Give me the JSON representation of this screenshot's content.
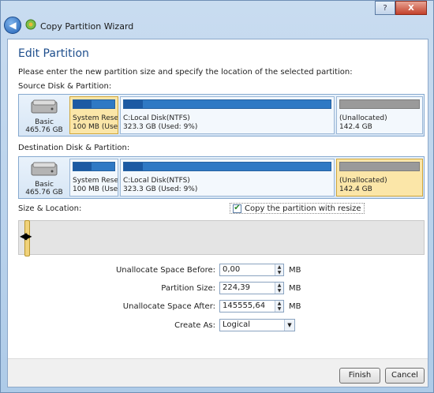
{
  "window": {
    "title": "Copy Partition Wizard",
    "minimize_glyph": "?",
    "close_glyph": "X"
  },
  "page": {
    "heading": "Edit Partition",
    "instructions": "Please enter the new partition size and specify the location of the selected partition:"
  },
  "source": {
    "label": "Source Disk & Partition:",
    "disk": {
      "type": "Basic",
      "size": "465.76 GB"
    },
    "partitions": [
      {
        "line1": "System Reser",
        "line2": "100 MB (Used:",
        "used_fraction": 0.45,
        "selected": true
      },
      {
        "line1": "C:Local Disk(NTFS)",
        "line2": "323.3 GB (Used: 9%)",
        "used_fraction": 0.09,
        "selected": false
      },
      {
        "line1": "(Unallocated)",
        "line2": "142.4 GB",
        "used_fraction": 0,
        "selected": false
      }
    ]
  },
  "destination": {
    "label": "Destination Disk & Partition:",
    "disk": {
      "type": "Basic",
      "size": "465.76 GB"
    },
    "partitions": [
      {
        "line1": "System Reser",
        "line2": "100 MB (Used:",
        "used_fraction": 0.45,
        "selected": false
      },
      {
        "line1": "C:Local Disk(NTFS)",
        "line2": "323.3 GB (Used: 9%)",
        "used_fraction": 0.09,
        "selected": false
      },
      {
        "line1": "(Unallocated)",
        "line2": "142.4 GB",
        "used_fraction": 0,
        "selected": true
      }
    ]
  },
  "size_location": {
    "label": "Size & Location:",
    "resize_checkbox_label": "Copy the partition with resize",
    "resize_checked": true
  },
  "form": {
    "before_label": "Unallocate Space Before:",
    "before_value": "0,00",
    "size_label": "Partition Size:",
    "size_value": "224,39",
    "after_label": "Unallocate Space After:",
    "after_value": "145555,64",
    "unit": "MB",
    "create_as_label": "Create As:",
    "create_as_value": "Logical"
  },
  "buttons": {
    "finish": "Finish",
    "cancel": "Cancel"
  },
  "colors": {
    "accent": "#1e4e8c",
    "selected_partition": "#fbe6a8",
    "used_bar": "#2f79c4"
  }
}
